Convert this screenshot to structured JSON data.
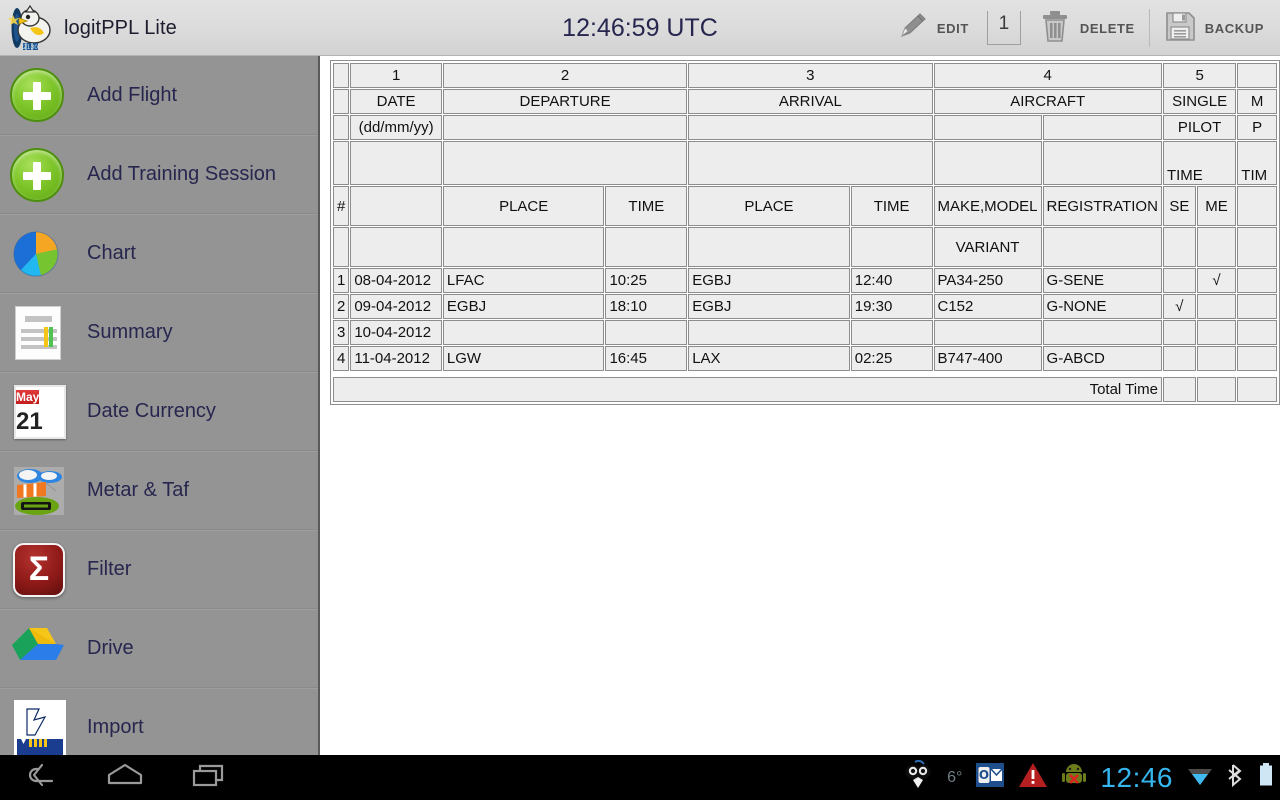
{
  "appbar": {
    "app_name": "logitPPL Lite",
    "logo_icon": "chick-propeller-icon",
    "utc_clock": "12:46:59 UTC",
    "actions": [
      {
        "label": "EDIT",
        "icon": "pencil-icon"
      },
      {
        "label": "DELETE",
        "icon": "trash-icon"
      },
      {
        "label": "BACKUP",
        "icon": "floppy-disk-icon"
      }
    ],
    "edit_count_value": "1"
  },
  "sidebar": {
    "items": [
      {
        "label": "Add Flight",
        "icon": "plus-circle-icon"
      },
      {
        "label": "Add Training Session",
        "icon": "plus-circle-icon"
      },
      {
        "label": "Chart",
        "icon": "pie-chart-icon"
      },
      {
        "label": "Summary",
        "icon": "document-summary-icon"
      },
      {
        "label": "Date Currency",
        "icon": "calendar-icon"
      },
      {
        "label": "Metar & Taf",
        "icon": "windsock-weather-icon"
      },
      {
        "label": "Filter",
        "icon": "sigma-filter-icon"
      },
      {
        "label": "Drive",
        "icon": "google-drive-icon"
      },
      {
        "label": "Import",
        "icon": "import-icon"
      }
    ],
    "calendar_icon": {
      "month": "May",
      "day": "21"
    },
    "sigma_glyph": "Σ"
  },
  "logbook": {
    "column_numbers": [
      "1",
      "2",
      "3",
      "4",
      "5"
    ],
    "group_headers": [
      "DATE",
      "DEPARTURE",
      "ARRIVAL",
      "AIRCRAFT",
      "SINGLE",
      "M"
    ],
    "subheader_row2": [
      "(dd/mm/yy)",
      "PILOT",
      "P"
    ],
    "time_labels": [
      "TIME",
      "TIM"
    ],
    "field_headers": {
      "num": "#",
      "place": "PLACE",
      "time": "TIME",
      "make_model": "MAKE,MODEL",
      "registration": "REGISTRATION",
      "se": "SE",
      "me": "ME"
    },
    "variant_label": "VARIANT",
    "total_label": "Total Time",
    "check_glyph": "√",
    "rows": [
      {
        "num": "1",
        "date": "08-04-2012",
        "dep_place": "LFAC",
        "dep_time": "10:25",
        "arr_place": "EGBJ",
        "arr_time": "12:40",
        "make_model": "PA34-250",
        "registration": "G-SENE",
        "se": "",
        "me": "√",
        "mp": ""
      },
      {
        "num": "2",
        "date": "09-04-2012",
        "dep_place": "EGBJ",
        "dep_time": "18:10",
        "arr_place": "EGBJ",
        "arr_time": "19:30",
        "make_model": "C152",
        "registration": "G-NONE",
        "se": "√",
        "me": "",
        "mp": ""
      },
      {
        "num": "3",
        "date": "10-04-2012",
        "dep_place": "",
        "dep_time": "",
        "arr_place": "",
        "arr_time": "",
        "make_model": "",
        "registration": "",
        "se": "",
        "me": "",
        "mp": ""
      },
      {
        "num": "4",
        "date": "11-04-2012",
        "dep_place": "LGW",
        "dep_time": "16:45",
        "arr_place": "LAX",
        "arr_time": "02:25",
        "make_model": "B747-400",
        "registration": "G-ABCD",
        "se": "",
        "me": "",
        "mp": ""
      }
    ],
    "totals": {
      "se": "",
      "me": "",
      "mp": ""
    }
  },
  "navbar": {
    "back_icon": "back-arrow-icon",
    "home_icon": "home-icon",
    "recents_icon": "recent-apps-icon",
    "status": {
      "bird_icon": "bird-icon",
      "temperature": "6°",
      "mail_icon": "outlook-mail-icon",
      "warning_icon": "warning-triangle-icon",
      "android_icon": "android-error-icon",
      "clock": "12:46",
      "wifi_icon": "wifi-icon",
      "bluetooth_icon": "bluetooth-icon",
      "battery_icon": "battery-icon"
    }
  },
  "colors": {
    "sidebar_bg": "#949494",
    "appbar_bg": "#dcdcdc",
    "label_text": "#26264f",
    "accent_green": "#7ec62a",
    "system_clock": "#36b6ef"
  }
}
